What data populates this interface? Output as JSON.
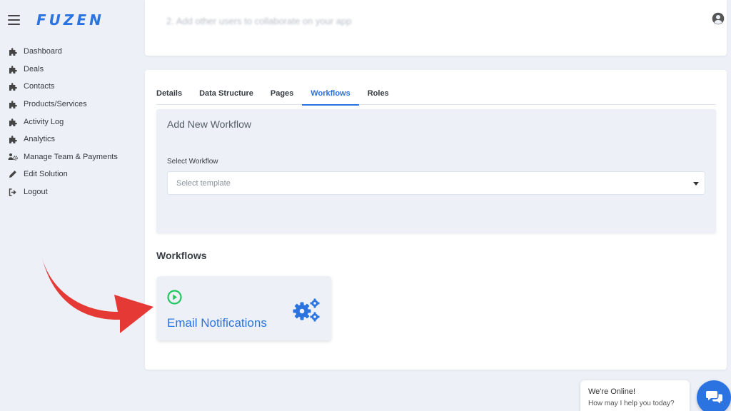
{
  "app": {
    "logo": "FUZEN",
    "brand_color": "#2a73e0"
  },
  "sidebar": {
    "items": [
      {
        "label": "Dashboard",
        "icon": "puzzle-icon"
      },
      {
        "label": "Deals",
        "icon": "puzzle-icon"
      },
      {
        "label": "Contacts",
        "icon": "puzzle-icon"
      },
      {
        "label": "Products/Services",
        "icon": "puzzle-icon"
      },
      {
        "label": "Activity Log",
        "icon": "puzzle-icon"
      },
      {
        "label": "Analytics",
        "icon": "puzzle-icon"
      },
      {
        "label": "Manage Team & Payments",
        "icon": "users-cog-icon"
      },
      {
        "label": "Edit Solution",
        "icon": "pencil-icon"
      },
      {
        "label": "Logout",
        "icon": "sign-out-icon"
      }
    ]
  },
  "top_card": {
    "faded_text": "2. Add other users to collaborate on your app"
  },
  "tabs": [
    {
      "label": "Details",
      "active": false
    },
    {
      "label": "Data Structure",
      "active": false
    },
    {
      "label": "Pages",
      "active": false
    },
    {
      "label": "Workflows",
      "active": true
    },
    {
      "label": "Roles",
      "active": false
    }
  ],
  "add_workflow": {
    "title": "Add New Workflow",
    "field_label": "Select Workflow",
    "placeholder": "Select template"
  },
  "workflows": {
    "title": "Workflows",
    "items": [
      {
        "label": "Email Notifications",
        "status_icon": "play-circle-icon",
        "status_color": "#22c55e",
        "icon": "gears-icon"
      }
    ]
  },
  "chat": {
    "line1": "We're Online!",
    "line2": "How may I help you today?"
  },
  "annotation": {
    "arrow_color": "#e53935"
  }
}
